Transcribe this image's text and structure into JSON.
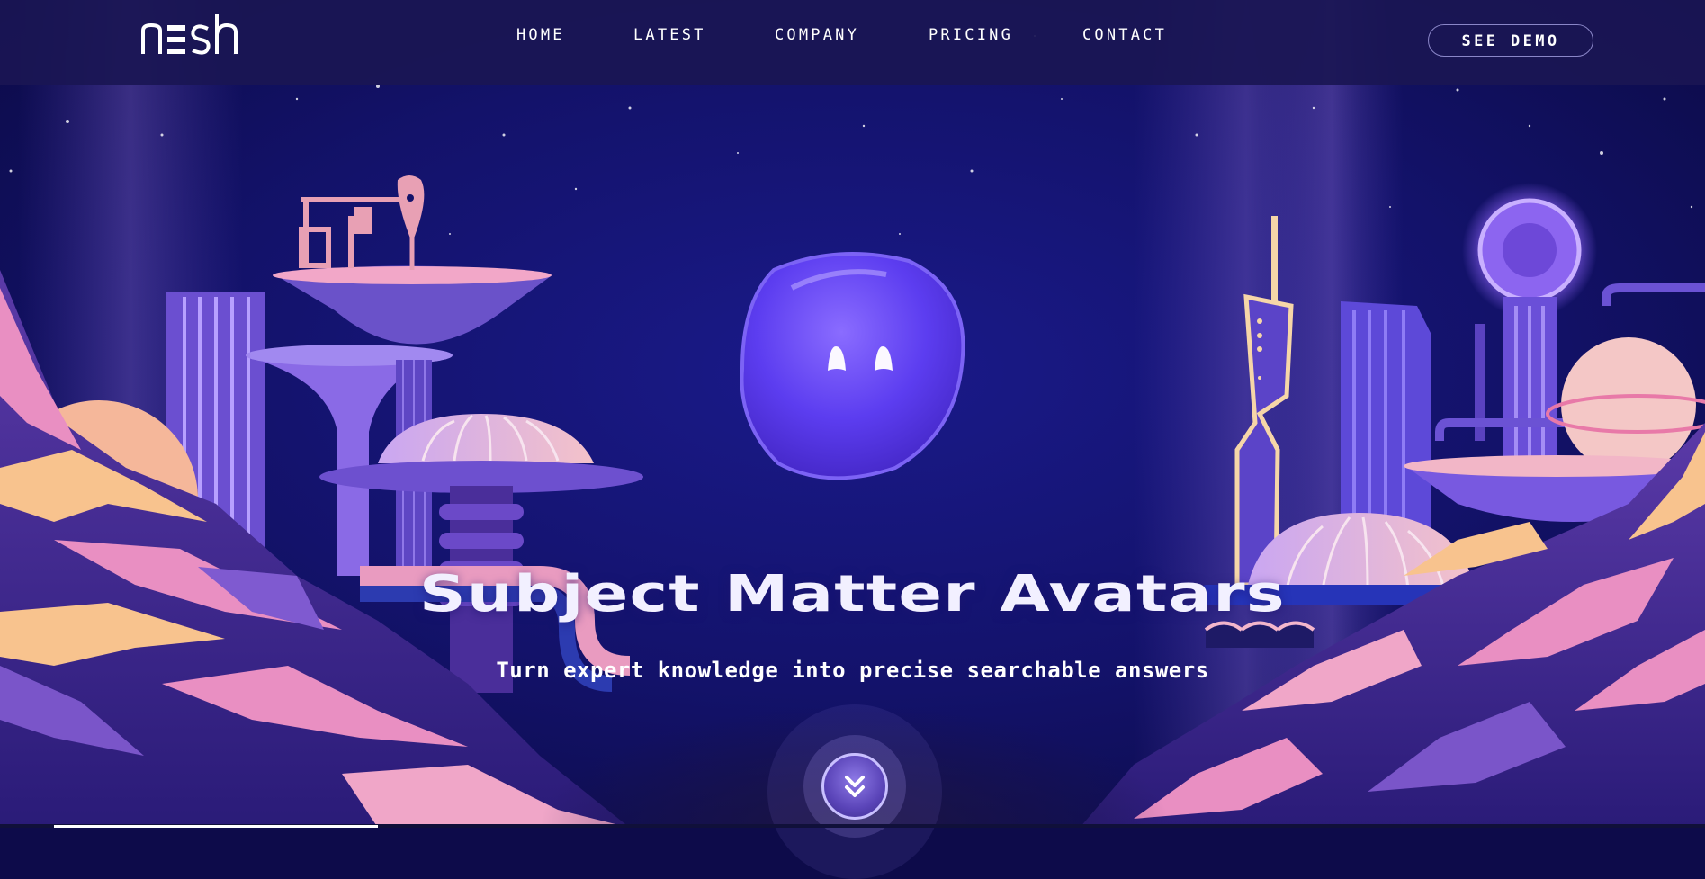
{
  "app": {
    "logo_text": "nesh"
  },
  "nav": {
    "items": [
      "HOME",
      "LATEST",
      "COMPANY",
      "PRICING",
      "CONTACT"
    ],
    "cta_label": "SEE DEMO"
  },
  "hero": {
    "title": "Subject Matter Avatars",
    "subtitle": "Turn expert knowledge into precise searchable answers",
    "scroll_icon": "double-chevron-down-icon"
  },
  "colors": {
    "sky": "#0d0b4a",
    "nav_bg": "#1a1654",
    "accent_purple": "#6b4df0",
    "rock_pink": "#e98fc2",
    "rock_peach": "#f8c38e"
  }
}
